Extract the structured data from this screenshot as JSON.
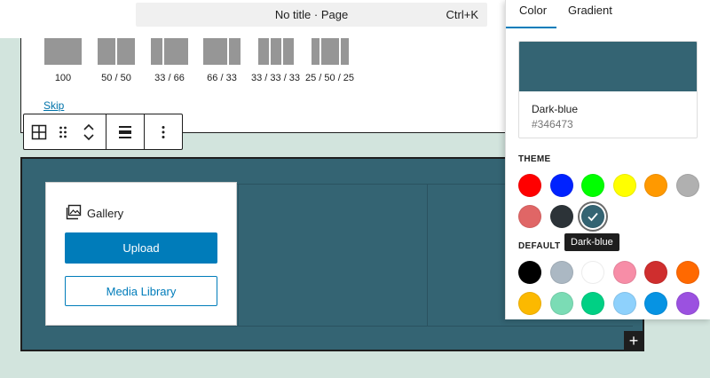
{
  "header": {
    "title": "No title · Page",
    "shortcut": "Ctrl+K"
  },
  "columns_picker": {
    "variations": [
      {
        "label": "100"
      },
      {
        "label": "50 / 50"
      },
      {
        "label": "33 / 66"
      },
      {
        "label": "66 / 33"
      },
      {
        "label": "33 / 33 / 33"
      },
      {
        "label": "25 / 50 / 25"
      }
    ],
    "skip_label": "Skip"
  },
  "toolbar": {
    "icons": [
      "columns-icon",
      "drag-handle-icon",
      "move-up-down-icon",
      "align-icon",
      "more-options-icon"
    ]
  },
  "gallery": {
    "title": "Gallery",
    "upload_label": "Upload",
    "media_library_label": "Media Library"
  },
  "add_block_label": "+",
  "color_panel": {
    "tabs": [
      "Color",
      "Gradient"
    ],
    "active_tab": "Color",
    "selected": {
      "name": "Dark-blue",
      "hex": "#346473"
    },
    "theme_label": "THEME",
    "default_label": "DEFAULT",
    "tooltip": "Dark-blue",
    "theme_colors": [
      "#ff0000",
      "#0022ff",
      "#00ff00",
      "#ffff00",
      "#ff9900",
      "#b0b0b0",
      "#e06666",
      "#2c3338",
      "#346473"
    ],
    "default_colors": [
      "#000000",
      "#abb8c3",
      "#ffffff",
      "#f78da7",
      "#cf2e2e",
      "#ff6900",
      "#fcb900",
      "#7bdcb5",
      "#00d084",
      "#8ed1fc",
      "#0693e3",
      "#9b51e0"
    ]
  },
  "colors": {
    "accent": "#007cba",
    "cover_bg": "#346473",
    "page_bg": "#d2e4dd"
  }
}
